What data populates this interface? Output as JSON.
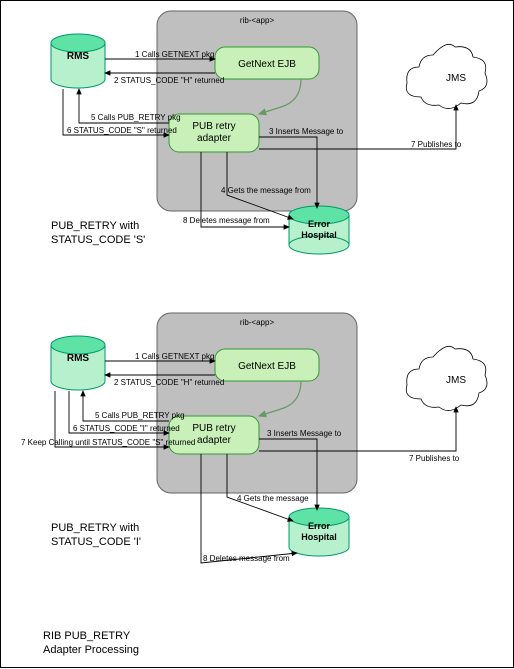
{
  "diagram1": {
    "container": "rib-<app>",
    "rms": "RMS",
    "getnext": "GetNext EJB",
    "pubretry_l1": "PUB retry",
    "pubretry_l2": "adapter",
    "error_l1": "Error",
    "error_l2": "Hospital",
    "jms": "JMS",
    "edges": {
      "e1": "1 Calls GETNEXT pkg",
      "e2": "2 STATUS_CODE \"H\" returned",
      "e3": "3 Inserts Message to",
      "e4": "4 Gets the message from",
      "e5": "5 Calls PUB_RETRY pkg",
      "e6": "6 STATUS_CODE \"S\" returned",
      "e7": "7 Publishes to",
      "e8": "8 Deletes message from"
    },
    "caption_l1": "PUB_RETRY with",
    "caption_l2": "STATUS_CODE 'S'"
  },
  "diagram2": {
    "container": "rib-<app>",
    "rms": "RMS",
    "getnext": "GetNext EJB",
    "pubretry_l1": "PUB retry",
    "pubretry_l2": "adapter",
    "error_l1": "Error",
    "error_l2": "Hospital",
    "jms": "JMS",
    "edges": {
      "e1": "1 Calls GETNEXT pkg",
      "e2": "2 STATUS_CODE \"H\" returned",
      "e3": "3 Inserts Message to",
      "e4": "4 Gets the message",
      "e5": "5 Calls PUB_RETRY pkg",
      "e6": "6 STATUS_CODE \"I\" returned",
      "e7": "7 Publishes to",
      "e7b": "7 Keep Calling until STATUS_CODE \"S\" returned",
      "e8": "8 Deletes message from"
    },
    "caption_l1": "PUB_RETRY with",
    "caption_l2": "STATUS_CODE 'I'"
  },
  "footer_l1": "RIB PUB_RETRY",
  "footer_l2": "Adapter Processing",
  "chart_data": {
    "type": "flow-diagram",
    "diagrams": [
      {
        "title": "PUB_RETRY with STATUS_CODE 'S'",
        "container": "rib-<app>",
        "nodes": [
          "RMS",
          "GetNext EJB",
          "PUB retry adapter",
          "Error Hospital",
          "JMS"
        ],
        "edges": [
          {
            "n": 1,
            "from": "RMS",
            "to": "GetNext EJB",
            "label": "Calls GETNEXT pkg"
          },
          {
            "n": 2,
            "from": "GetNext EJB",
            "to": "RMS",
            "label": "STATUS_CODE \"H\" returned"
          },
          {
            "n": 3,
            "from": "GetNext EJB",
            "to": "Error Hospital",
            "label": "Inserts Message to"
          },
          {
            "n": 4,
            "from": "PUB retry adapter",
            "to": "Error Hospital",
            "label": "Gets the message from"
          },
          {
            "n": 5,
            "from": "PUB retry adapter",
            "to": "RMS",
            "label": "Calls PUB_RETRY pkg"
          },
          {
            "n": 6,
            "from": "RMS",
            "to": "PUB retry adapter",
            "label": "STATUS_CODE \"S\" returned"
          },
          {
            "n": 7,
            "from": "PUB retry adapter",
            "to": "JMS",
            "label": "Publishes to"
          },
          {
            "n": 8,
            "from": "PUB retry adapter",
            "to": "Error Hospital",
            "label": "Deletes message from"
          }
        ]
      },
      {
        "title": "PUB_RETRY with STATUS_CODE 'I'",
        "container": "rib-<app>",
        "nodes": [
          "RMS",
          "GetNext EJB",
          "PUB retry adapter",
          "Error Hospital",
          "JMS"
        ],
        "edges": [
          {
            "n": 1,
            "from": "RMS",
            "to": "GetNext EJB",
            "label": "Calls GETNEXT pkg"
          },
          {
            "n": 2,
            "from": "GetNext EJB",
            "to": "RMS",
            "label": "STATUS_CODE \"H\" returned"
          },
          {
            "n": 3,
            "from": "GetNext EJB",
            "to": "Error Hospital",
            "label": "Inserts Message to"
          },
          {
            "n": 4,
            "from": "PUB retry adapter",
            "to": "Error Hospital",
            "label": "Gets the message"
          },
          {
            "n": 5,
            "from": "PUB retry adapter",
            "to": "RMS",
            "label": "Calls PUB_RETRY pkg"
          },
          {
            "n": 6,
            "from": "RMS",
            "to": "PUB retry adapter",
            "label": "STATUS_CODE \"I\" returned"
          },
          {
            "n": 7,
            "from": "PUB retry adapter",
            "to": "RMS",
            "label": "Keep Calling until STATUS_CODE \"S\" returned"
          },
          {
            "n": 7,
            "from": "PUB retry adapter",
            "to": "JMS",
            "label": "Publishes to"
          },
          {
            "n": 8,
            "from": "PUB retry adapter",
            "to": "Error Hospital",
            "label": "Deletes message from"
          }
        ]
      }
    ]
  }
}
